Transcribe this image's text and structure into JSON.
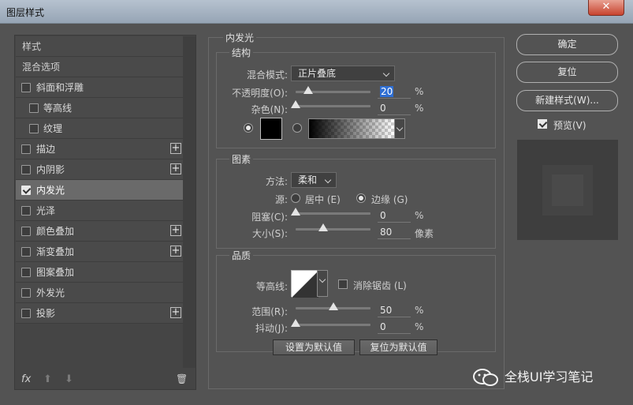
{
  "window": {
    "title": "图层样式",
    "close_glyph": "✕"
  },
  "left": {
    "header_items": [
      "样式",
      "混合选项"
    ],
    "items": [
      {
        "label": "斜面和浮雕",
        "checked": false,
        "plus": false,
        "indent": 0
      },
      {
        "label": "等高线",
        "checked": false,
        "plus": false,
        "indent": 1
      },
      {
        "label": "纹理",
        "checked": false,
        "plus": false,
        "indent": 1
      },
      {
        "label": "描边",
        "checked": false,
        "plus": true,
        "indent": 0
      },
      {
        "label": "内阴影",
        "checked": false,
        "plus": true,
        "indent": 0
      },
      {
        "label": "内发光",
        "checked": true,
        "plus": false,
        "indent": 0,
        "selected": true
      },
      {
        "label": "光泽",
        "checked": false,
        "plus": false,
        "indent": 0
      },
      {
        "label": "颜色叠加",
        "checked": false,
        "plus": true,
        "indent": 0
      },
      {
        "label": "渐变叠加",
        "checked": false,
        "plus": true,
        "indent": 0
      },
      {
        "label": "图案叠加",
        "checked": false,
        "plus": false,
        "indent": 0
      },
      {
        "label": "外发光",
        "checked": false,
        "plus": false,
        "indent": 0
      },
      {
        "label": "投影",
        "checked": false,
        "plus": true,
        "indent": 0
      }
    ],
    "plus_glyph": "+",
    "tools": {
      "fx": "fx",
      "up": "⬆",
      "down": "⬇",
      "trash": "🗑"
    }
  },
  "panel": {
    "title": "内发光",
    "structure": {
      "title": "结构",
      "blend_mode_label": "混合模式:",
      "blend_mode_value": "正片叠底",
      "opacity_label": "不透明度(O):",
      "opacity_value": "20",
      "noise_label": "杂色(N):",
      "noise_value": "0",
      "percent": "%"
    },
    "elements": {
      "title": "图素",
      "method_label": "方法:",
      "method_value": "柔和",
      "source_label": "源:",
      "source_center": "居中 (E)",
      "source_edge": "边缘 (G)",
      "choke_label": "阻塞(C):",
      "choke_value": "0",
      "size_label": "大小(S):",
      "size_value": "80",
      "size_unit": "像素",
      "percent": "%"
    },
    "quality": {
      "title": "品质",
      "contour_label": "等高线:",
      "antialias_label": "消除锯齿 (L)",
      "range_label": "范围(R):",
      "range_value": "50",
      "jitter_label": "抖动(J):",
      "jitter_value": "0",
      "percent": "%"
    },
    "buttons": {
      "set_default": "设置为默认值",
      "reset_default": "复位为默认值"
    }
  },
  "right": {
    "ok": "确定",
    "reset": "复位",
    "new_style": "新建样式(W)...",
    "preview_label": "预览(V)",
    "preview_checked": true
  },
  "watermark": {
    "text": "全栈UI学习笔记"
  }
}
